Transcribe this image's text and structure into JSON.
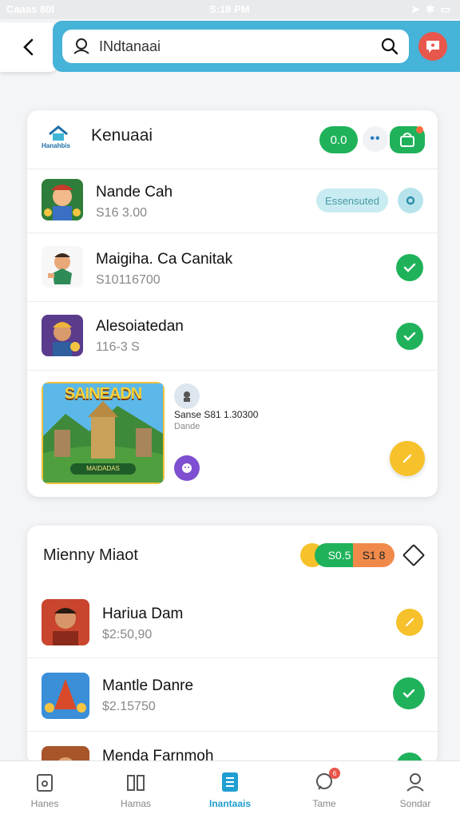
{
  "status_bar": {
    "carrier": "Caaas 80I",
    "time": "S:18 PM"
  },
  "search": {
    "value": "INdtanaai"
  },
  "colors": {
    "accent": "#46b3d8",
    "green": "#1fb25a",
    "yellow": "#f6c12a",
    "orange": "#f08a4b"
  },
  "section1": {
    "title": "Kenuaai",
    "brand_text": "Hanahbis",
    "pill_label": "0.0",
    "items": [
      {
        "title": "Nande Cah",
        "sub": "S16 3.00",
        "badge": "Essensuted",
        "icon": "settings-icon"
      },
      {
        "title": "Maigiha. Ca Canitak",
        "sub": "S10116700",
        "icon": "check-icon"
      },
      {
        "title": "Alesoiatedan",
        "sub": "116-3 S",
        "icon": "check-icon"
      }
    ],
    "feature": {
      "image_title": "SAINEADN",
      "image_sub": "MAIDADAS",
      "meta": "Sanse  S81 1.30300",
      "meta_sub": "Dande"
    }
  },
  "section2": {
    "title": "Mienny  Miaot",
    "stat_a": "S0.5",
    "stat_b": "S1 8",
    "items": [
      {
        "title": "Hariua Dam",
        "sub": "$2:50,90",
        "icon": "edit-icon"
      },
      {
        "title": "Mantle Danre",
        "sub": "$2.15750",
        "icon": "check-icon"
      },
      {
        "title": "Menda Farnmoh",
        "sub": "",
        "icon": "check-icon"
      }
    ]
  },
  "nav": [
    {
      "label": "Hanes",
      "icon": "home-icon"
    },
    {
      "label": "Hamas",
      "icon": "library-icon"
    },
    {
      "label": "Inantaais",
      "icon": "list-icon",
      "active": true
    },
    {
      "label": "Tame",
      "icon": "messages-icon",
      "badge": "6"
    },
    {
      "label": "Sondar",
      "icon": "profile-icon"
    }
  ]
}
